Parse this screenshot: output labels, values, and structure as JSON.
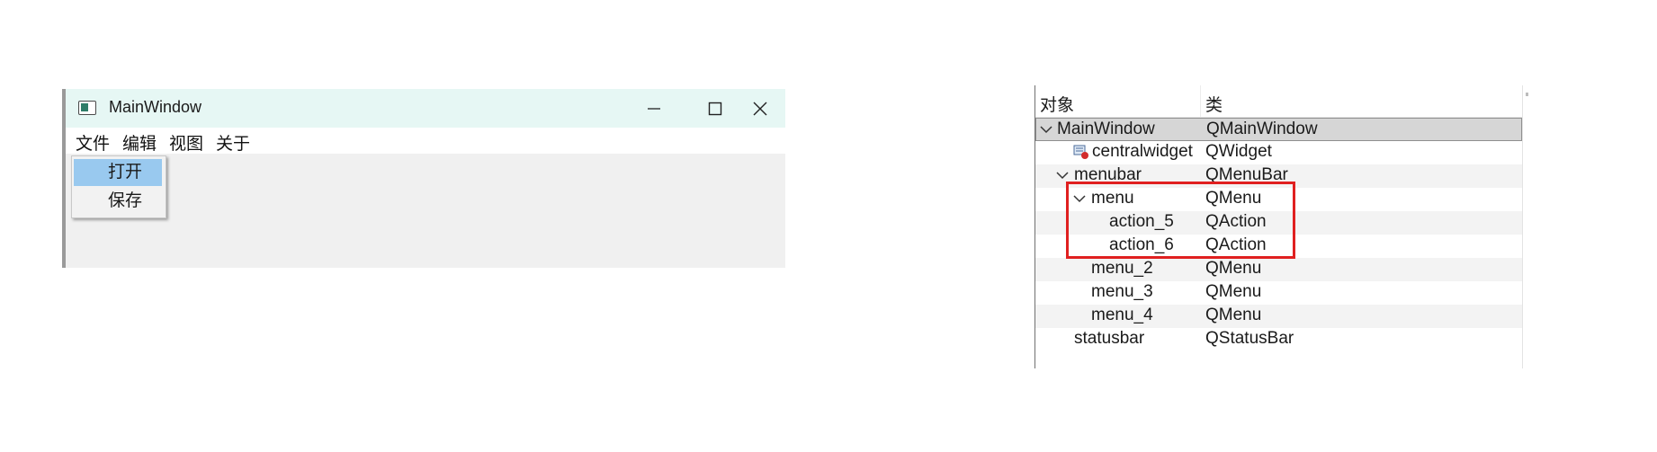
{
  "main_window": {
    "title": "MainWindow",
    "menus": [
      "文件",
      "编辑",
      "视图",
      "关于"
    ],
    "open_menu": {
      "items": [
        {
          "label": "打开",
          "highlighted": true
        },
        {
          "label": "保存",
          "highlighted": false
        }
      ]
    },
    "icons": {
      "app": "app-window-icon",
      "minimize": "minimize-icon",
      "maximize": "maximize-icon",
      "close": "close-icon"
    }
  },
  "object_inspector": {
    "headers": {
      "object": "对象",
      "class": "类"
    },
    "rows": [
      {
        "name": "MainWindow",
        "cls": "QMainWindow",
        "level": 0,
        "expander": true,
        "selected": true
      },
      {
        "name": "centralwidget",
        "cls": "QWidget",
        "level": 1,
        "icon": "widget-icon"
      },
      {
        "name": "menubar",
        "cls": "QMenuBar",
        "level": 1,
        "expander": true
      },
      {
        "name": "menu",
        "cls": "QMenu",
        "level": 2,
        "expander": true
      },
      {
        "name": "action_5",
        "cls": "QAction",
        "level": 3
      },
      {
        "name": "action_6",
        "cls": "QAction",
        "level": 3
      },
      {
        "name": "menu_2",
        "cls": "QMenu",
        "level": 2
      },
      {
        "name": "menu_3",
        "cls": "QMenu",
        "level": 2
      },
      {
        "name": "menu_4",
        "cls": "QMenu",
        "level": 2
      },
      {
        "name": "statusbar",
        "cls": "QStatusBar",
        "level": 1
      }
    ],
    "highlight_color": "#e02020",
    "selection_color": "#d6d6d6"
  }
}
